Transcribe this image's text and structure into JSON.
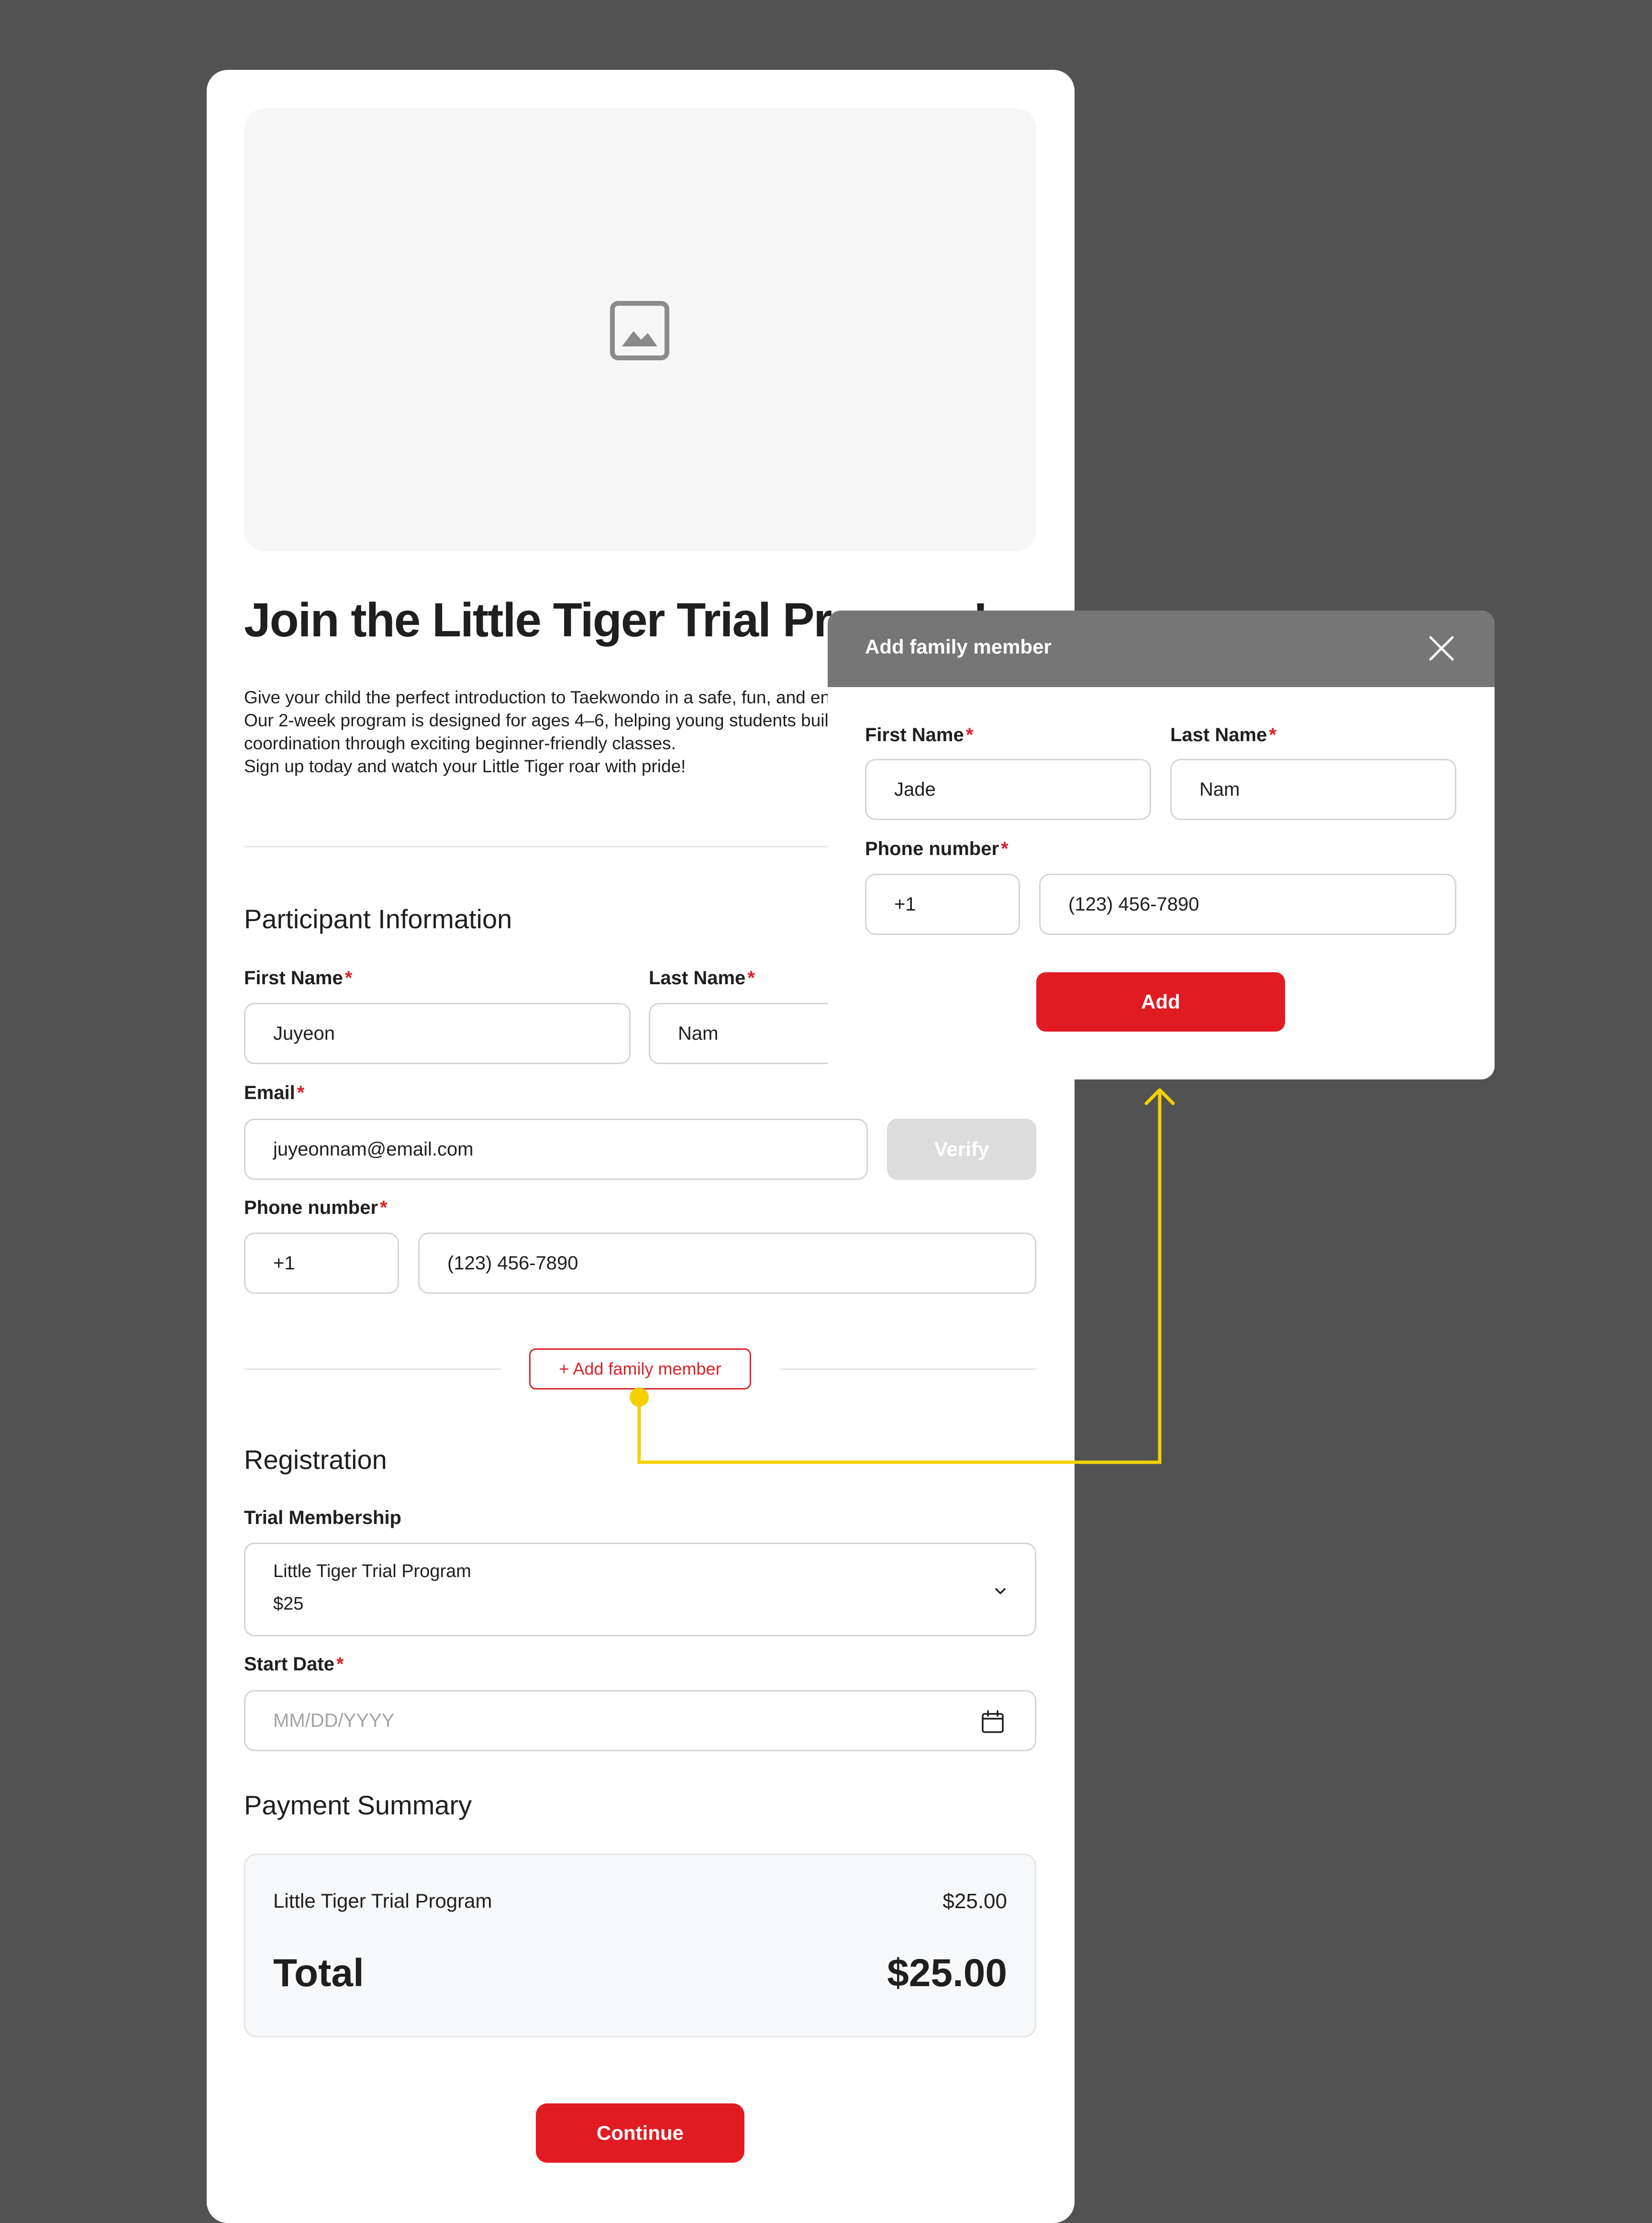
{
  "page": {
    "title": "Join the Little Tiger Trial Program!",
    "intro": [
      "Give your child the perfect introduction to Taekwondo in a safe, fun, and engaging environment.",
      "Our 2-week program is designed for ages 4–6, helping young students build confidence, focus, and",
      "coordination through exciting beginner-friendly classes.",
      "Sign up today and watch your Little Tiger roar with pride!"
    ]
  },
  "hero": {
    "icon": "image-placeholder-icon"
  },
  "participant": {
    "heading": "Participant Information",
    "first_name_label": "First Name",
    "first_name_value": "Juyeon",
    "last_name_label": "Last Name",
    "last_name_value": "Nam",
    "email_label": "Email",
    "email_value": "juyeonnam@email.com",
    "verify_label": "Verify",
    "phone_label": "Phone number",
    "phone_code": "+1",
    "phone_value": "(123) 456-7890",
    "required_mark": "*",
    "add_family_label": "+ Add family member"
  },
  "registration": {
    "heading": "Registration",
    "membership_label": "Trial Membership",
    "membership_name": "Little Tiger Trial Program",
    "membership_price": "$25",
    "start_date_label": "Start Date",
    "start_date_placeholder": "MM/DD/YYYY"
  },
  "payment": {
    "heading": "Payment Summary",
    "item_name": "Little Tiger Trial Program",
    "item_price": "$25.00",
    "total_label": "Total",
    "total_value": "$25.00"
  },
  "continue_label": "Continue",
  "modal": {
    "title": "Add family member",
    "first_name_label": "First Name",
    "first_name_value": "Jade",
    "last_name_label": "Last Name",
    "last_name_value": "Nam",
    "phone_label": "Phone number",
    "phone_code": "+1",
    "phone_value": "(123) 456-7890",
    "add_label": "Add"
  },
  "colors": {
    "background": "#525252",
    "accent_red": "#e11b22",
    "modal_header": "#767676",
    "connector_yellow": "#f5d000"
  }
}
